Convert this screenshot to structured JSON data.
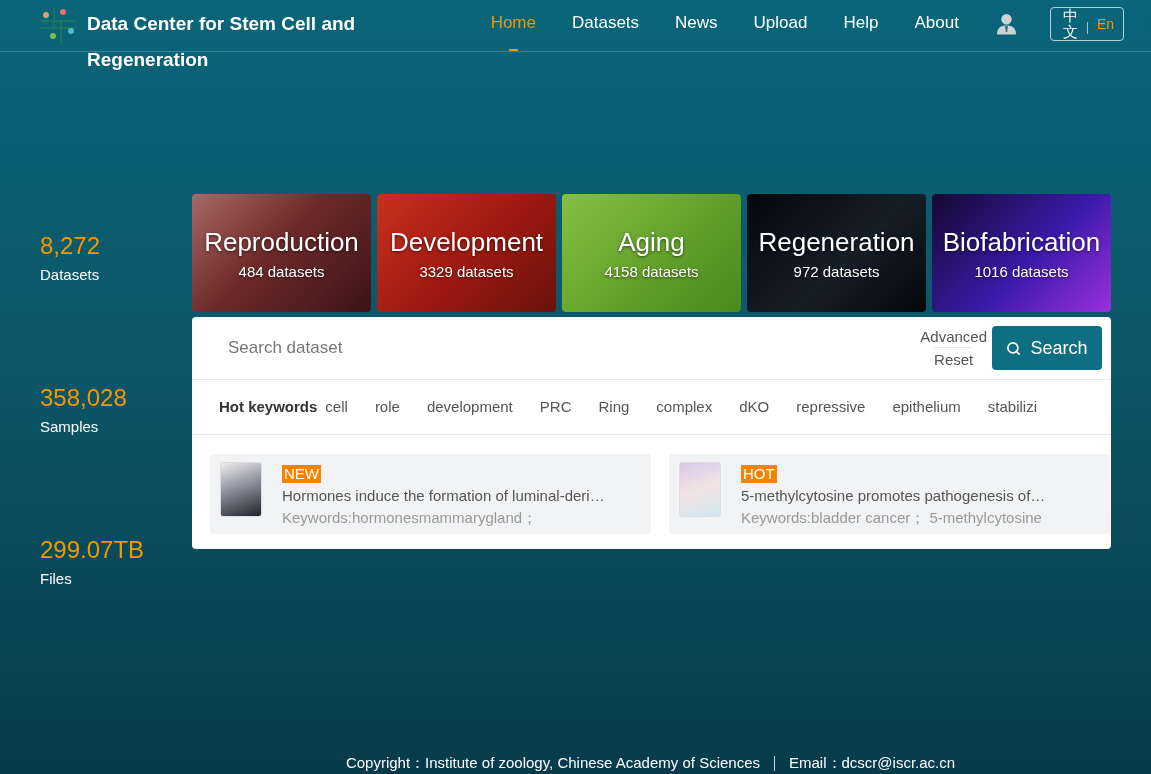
{
  "header": {
    "title": "Data Center for Stem Cell and Regeneration",
    "nav": [
      {
        "label": "Home",
        "selected": true
      },
      {
        "label": "Datasets",
        "selected": false
      },
      {
        "label": "News",
        "selected": false
      },
      {
        "label": "Upload",
        "selected": false
      },
      {
        "label": "Help",
        "selected": false
      },
      {
        "label": "About",
        "selected": false
      }
    ],
    "language": [
      {
        "label": "中文",
        "selected": false
      },
      {
        "label": "En",
        "selected": true
      }
    ]
  },
  "stats": [
    {
      "value": "8,272",
      "label": "Datasets"
    },
    {
      "value": "358,028",
      "label": "Samples"
    },
    {
      "value": "299.07TB",
      "label": "Files"
    }
  ],
  "categories": [
    {
      "name": "Reproduction",
      "count": "484 datasets"
    },
    {
      "name": "Development",
      "count": "3329 datasets"
    },
    {
      "name": "Aging",
      "count": "4158 datasets"
    },
    {
      "name": "Regeneration",
      "count": "972 datasets"
    },
    {
      "name": "Biofabrication",
      "count": "1016 datasets"
    }
  ],
  "search": {
    "placeholder": "Search dataset",
    "links": [
      "Advanced",
      "Reset"
    ],
    "button": "Search"
  },
  "hot_keywords": {
    "title": "Hot keywords",
    "items": [
      "cell",
      "role",
      "development",
      "PRC",
      "Ring",
      "complex",
      "dKO",
      "repressive",
      "epithelium",
      "stabilizi"
    ]
  },
  "articles": [
    {
      "badge": "NEW",
      "title": "Hormones induce the formation of luminal-deri…",
      "keywords": "Keywords:hormonesmammarygland；"
    },
    {
      "badge": "HOT",
      "title": "5-methylcytosine promotes pathogenesis of…",
      "keywords": "Keywords:bladder cancer； 5-methylcytosine"
    }
  ],
  "footer": {
    "copyright": "Copyright：Institute of zoology, Chinese Academy of Sciences",
    "email": "Email：dcscr@iscr.ac.cn"
  }
}
